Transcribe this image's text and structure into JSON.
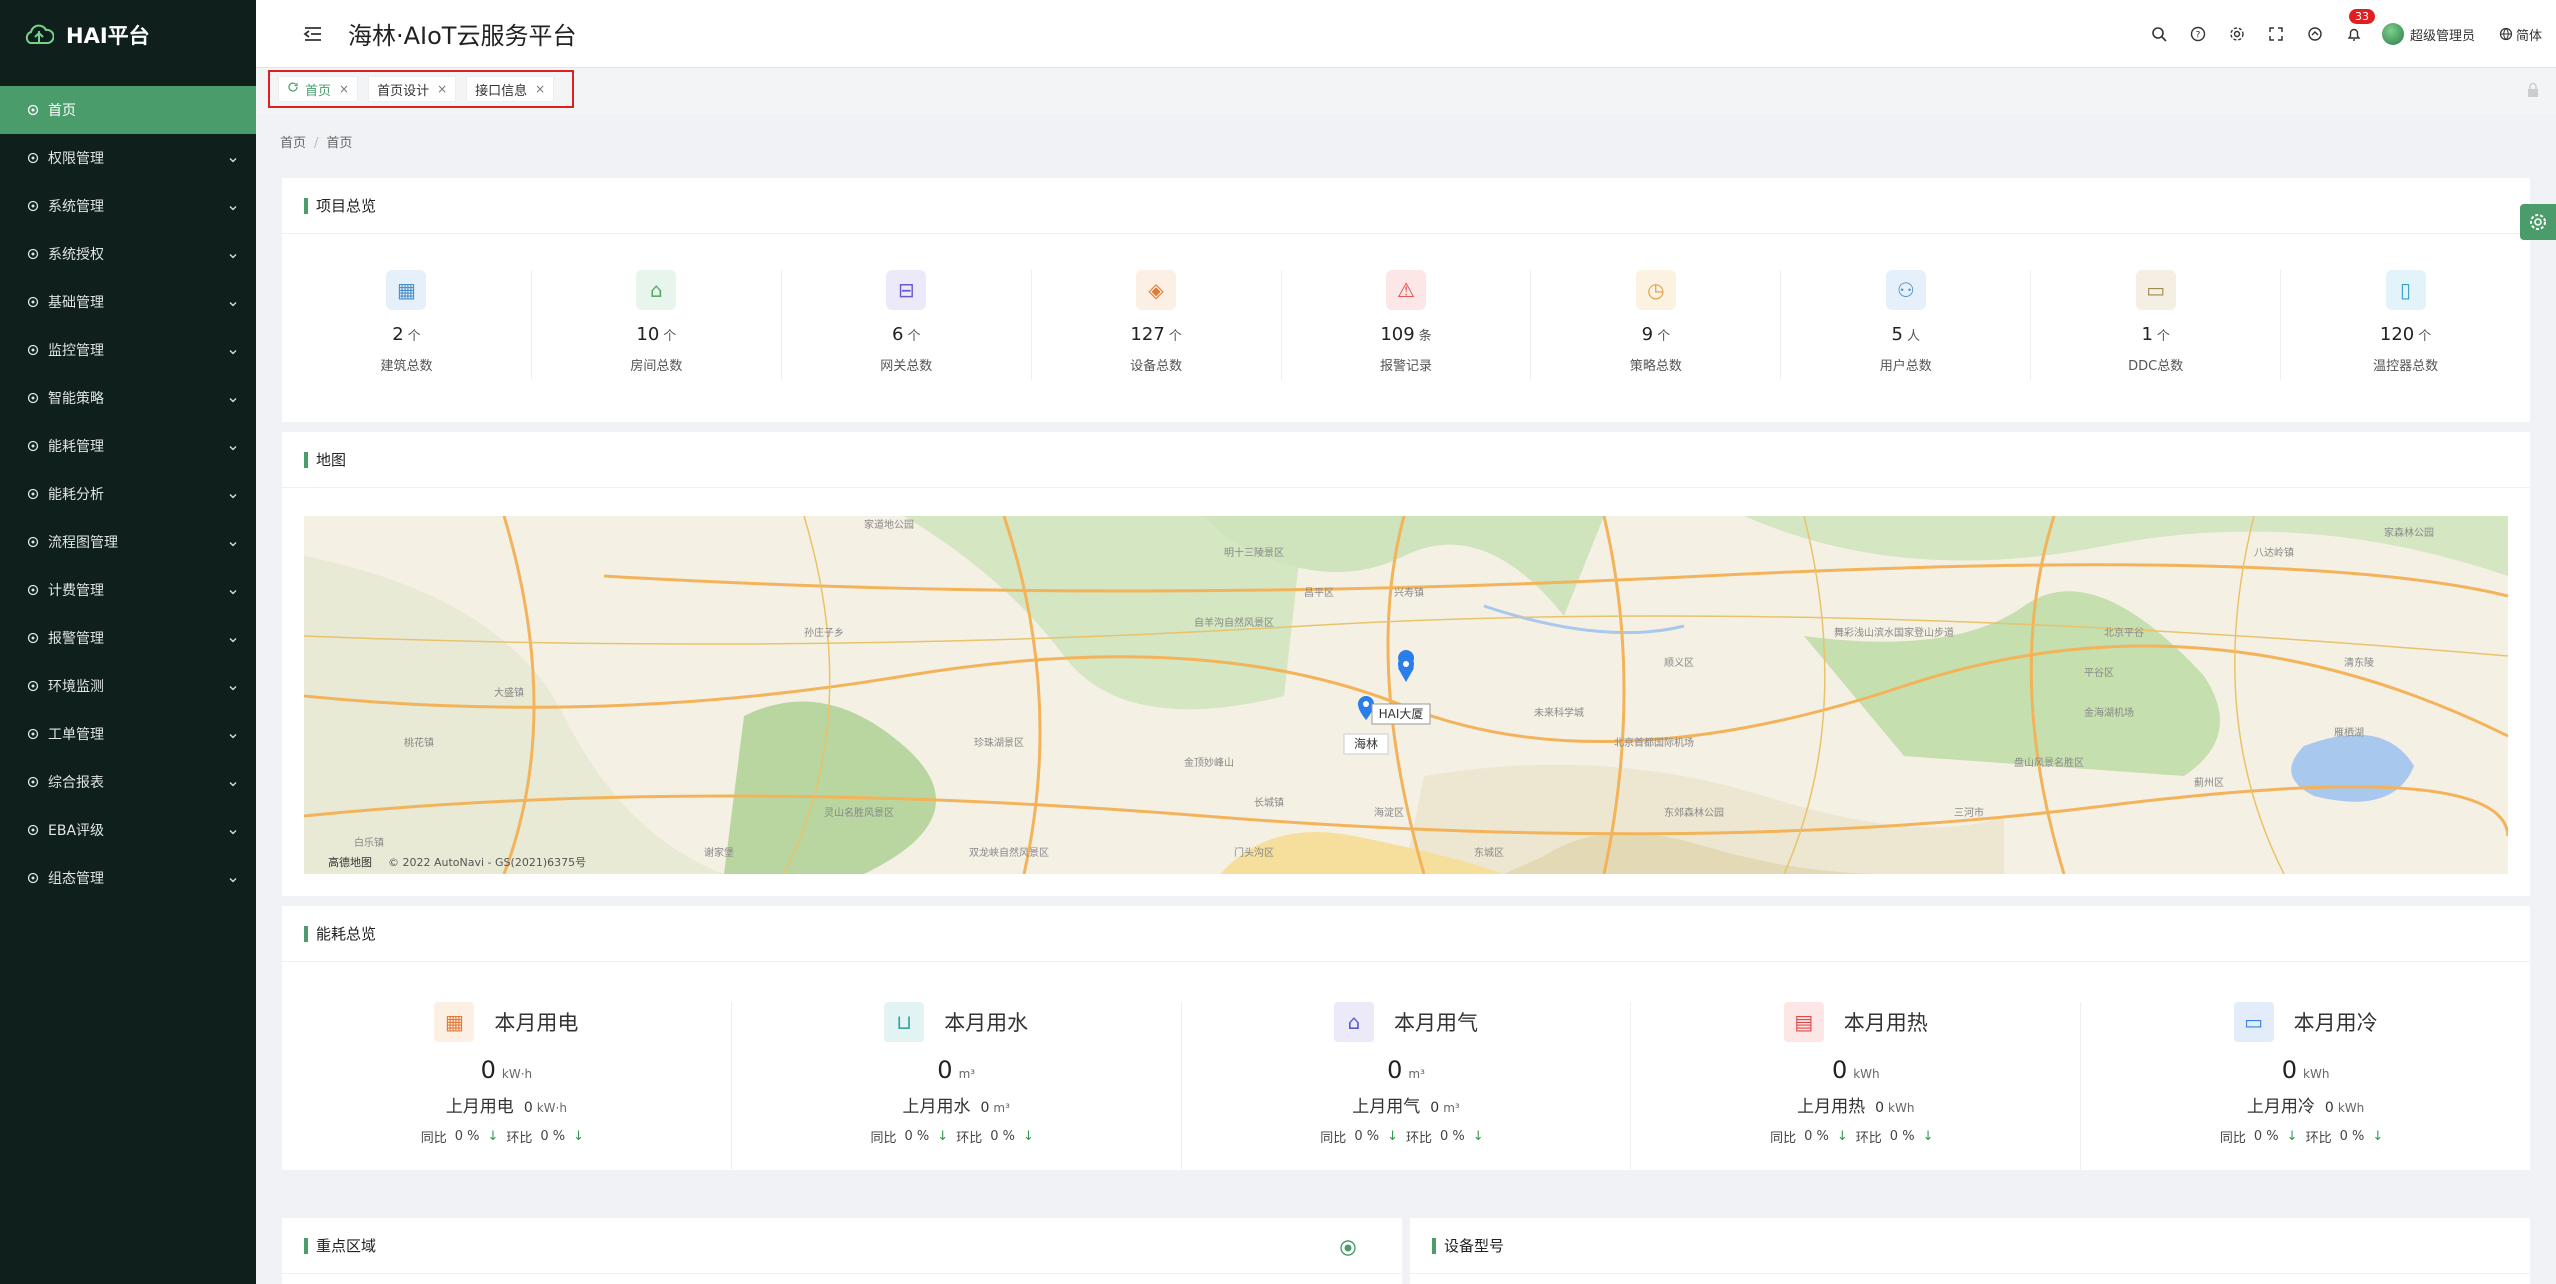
{
  "brand": "HAI平台",
  "header": {
    "title": "海林·AIoT云服务平台",
    "notifications": "33",
    "user": "超级管理员",
    "lang": "简体"
  },
  "sidebar": {
    "items": [
      {
        "label": "首页",
        "icon": "dashboard-icon"
      },
      {
        "label": "权限管理",
        "icon": "shield-icon"
      },
      {
        "label": "系统管理",
        "icon": "settings-icon"
      },
      {
        "label": "系统授权",
        "icon": "license-icon"
      },
      {
        "label": "基础管理",
        "icon": "monitor-icon"
      },
      {
        "label": "监控管理",
        "icon": "screen-icon"
      },
      {
        "label": "智能策略",
        "icon": "location-icon"
      },
      {
        "label": "能耗管理",
        "icon": "sliders-icon"
      },
      {
        "label": "能耗分析",
        "icon": "bar-chart-icon"
      },
      {
        "label": "流程图管理",
        "icon": "flow-icon"
      },
      {
        "label": "计费管理",
        "icon": "bill-icon"
      },
      {
        "label": "报警管理",
        "icon": "alarm-icon"
      },
      {
        "label": "环境监测",
        "icon": "env-icon"
      },
      {
        "label": "工单管理",
        "icon": "ticket-icon"
      },
      {
        "label": "综合报表",
        "icon": "report-icon"
      },
      {
        "label": "EBA评级",
        "icon": "rating-icon"
      },
      {
        "label": "组态管理",
        "icon": "config-icon"
      }
    ]
  },
  "tabs": [
    {
      "label": "首页"
    },
    {
      "label": "首页设计"
    },
    {
      "label": "接口信息"
    }
  ],
  "breadcrumb": [
    "首页",
    "首页"
  ],
  "overview": {
    "title": "项目总览",
    "items": [
      {
        "value": "2",
        "unit": "个",
        "label": "建筑总数",
        "color": "#4a90c8",
        "bg": "#e6f0fa"
      },
      {
        "value": "10",
        "unit": "个",
        "label": "房间总数",
        "color": "#5aa86a",
        "bg": "#e8f5ec"
      },
      {
        "value": "6",
        "unit": "个",
        "label": "网关总数",
        "color": "#6a5acd",
        "bg": "#eceaf8"
      },
      {
        "value": "127",
        "unit": "个",
        "label": "设备总数",
        "color": "#e07b39",
        "bg": "#fcefe4"
      },
      {
        "value": "109",
        "unit": "条",
        "label": "报警记录",
        "color": "#e04848",
        "bg": "#fce6e6"
      },
      {
        "value": "9",
        "unit": "个",
        "label": "策略总数",
        "color": "#e0a040",
        "bg": "#fcf2e2"
      },
      {
        "value": "5",
        "unit": "人",
        "label": "用户总数",
        "color": "#4a90c8",
        "bg": "#e6f0fa"
      },
      {
        "value": "1",
        "unit": "个",
        "label": "DDC总数",
        "color": "#a08a50",
        "bg": "#f4efe2"
      },
      {
        "value": "120",
        "unit": "个",
        "label": "温控器总数",
        "color": "#3aa0c8",
        "bg": "#e2f3fa"
      }
    ]
  },
  "map": {
    "title": "地图",
    "markers": [
      "HAI大厦",
      "海林"
    ],
    "attribution": "© 2022 AutoNavi - GS(2021)6375号",
    "logo": "高德地图",
    "labels": [
      "家道地公园",
      "明十三陵景区",
      "昌平区",
      "兴寿镇",
      "顺义区",
      "未来科学城",
      "北京首都国际机场",
      "海淀区",
      "东城区",
      "门头沟区",
      "珍珠湖景区",
      "灵山名胜风景区",
      "双龙峡自然风景区",
      "金顶妙峰山",
      "平谷区",
      "金海湖机场",
      "蓟州区",
      "三河市",
      "雁栖湖",
      "北京平谷",
      "清东陵",
      "盘山风景名胜区",
      "自羊沟自然风景区",
      "东郊森林公园",
      "舞彩浅山滨水国家登山步道",
      "八达岭镇",
      "家森林公园",
      "孙庄子乡",
      "大盛镇",
      "桃花镇",
      "白乐镇",
      "谢家堡",
      "长城镇"
    ]
  },
  "energy": {
    "title": "能耗总览",
    "items": [
      {
        "name": "本月用电",
        "value": "0",
        "unit": "kW·h",
        "last_label": "上月用电",
        "last_value": "0",
        "last_unit": "kW·h",
        "yoy": "0 %",
        "mom": "0 %",
        "color": "#e07b39",
        "bg": "#fcefe4"
      },
      {
        "name": "本月用水",
        "value": "0",
        "unit": "m³",
        "last_label": "上月用水",
        "last_value": "0",
        "last_unit": "m³",
        "yoy": "0 %",
        "mom": "0 %",
        "color": "#3aa0a0",
        "bg": "#e2f3f3"
      },
      {
        "name": "本月用气",
        "value": "0",
        "unit": "m³",
        "last_label": "上月用气",
        "last_value": "0",
        "last_unit": "m³",
        "yoy": "0 %",
        "mom": "0 %",
        "color": "#5a5acd",
        "bg": "#eceaf8"
      },
      {
        "name": "本月用热",
        "value": "0",
        "unit": "kWh",
        "last_label": "上月用热",
        "last_value": "0",
        "last_unit": "kWh",
        "yoy": "0 %",
        "mom": "0 %",
        "color": "#e04848",
        "bg": "#fce6e6"
      },
      {
        "name": "本月用冷",
        "value": "0",
        "unit": "kWh",
        "last_label": "上月用冷",
        "last_value": "0",
        "last_unit": "kWh",
        "yoy": "0 %",
        "mom": "0 %",
        "color": "#3a80e0",
        "bg": "#e2ecfa"
      }
    ],
    "yoy_label": "同比",
    "mom_label": "环比"
  },
  "zones": {
    "title": "重点区域"
  },
  "devices": {
    "title": "设备型号"
  }
}
